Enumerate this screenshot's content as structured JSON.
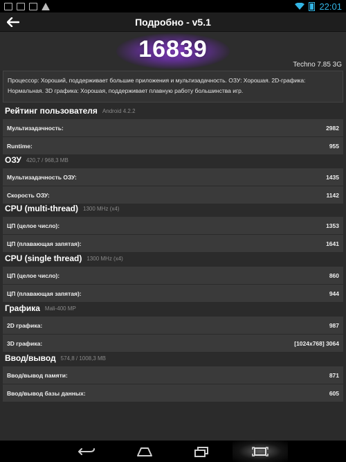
{
  "statusbar": {
    "icons": [
      "image-icon",
      "image-icon",
      "mail-icon",
      "warning-icon"
    ],
    "time": "22:01",
    "accent": "#33b5e5"
  },
  "header": {
    "title": "Подробно - v5.1"
  },
  "score": {
    "value": "16839",
    "device": "Techno 7.85 3G",
    "glow_color": "#8a3fd4"
  },
  "description": "Процессор: Хороший, поддерживает большие приложения и мультизадачность. ОЗУ: Хорошая. 2D-графика: Нормальная. 3D графика: Хорошая, поддерживает плавную работу большинства игр.",
  "sections": [
    {
      "title": "Рейтинг пользователя",
      "subtitle": "Android 4.2.2",
      "rows": [
        {
          "label": "Мультизадачность:",
          "value": "2982"
        },
        {
          "label": "Runtime:",
          "value": "955"
        }
      ]
    },
    {
      "title": "ОЗУ",
      "subtitle": "420,7 / 968,3 MB",
      "rows": [
        {
          "label": "Мультизадачность ОЗУ:",
          "value": "1435"
        },
        {
          "label": "Скорость ОЗУ:",
          "value": "1142"
        }
      ]
    },
    {
      "title": "CPU (multi-thread)",
      "subtitle": "1300 MHz (x4)",
      "rows": [
        {
          "label": "ЦП (целое число):",
          "value": "1353"
        },
        {
          "label": "ЦП (плавающая запятая):",
          "value": "1641"
        }
      ]
    },
    {
      "title": "CPU (single thread)",
      "subtitle": "1300 MHz (x4)",
      "rows": [
        {
          "label": "ЦП (целое число):",
          "value": "860"
        },
        {
          "label": "ЦП (плавающая запятая):",
          "value": "944"
        }
      ]
    },
    {
      "title": "Графика",
      "subtitle": "Mali-400 MP",
      "rows": [
        {
          "label": "2D графика:",
          "value": "987"
        },
        {
          "label": "3D графика:",
          "value": "[1024x768] 3064"
        }
      ]
    },
    {
      "title": "Ввод/вывод",
      "subtitle": "574,8 / 1008,3 MB",
      "rows": [
        {
          "label": "Ввод/вывод памяти:",
          "value": "871"
        },
        {
          "label": "Ввод/вывод базы данных:",
          "value": "605"
        }
      ]
    }
  ],
  "navbar": {
    "buttons": [
      "back-icon",
      "home-icon",
      "recent-apps-icon",
      "screenshot-icon"
    ]
  }
}
